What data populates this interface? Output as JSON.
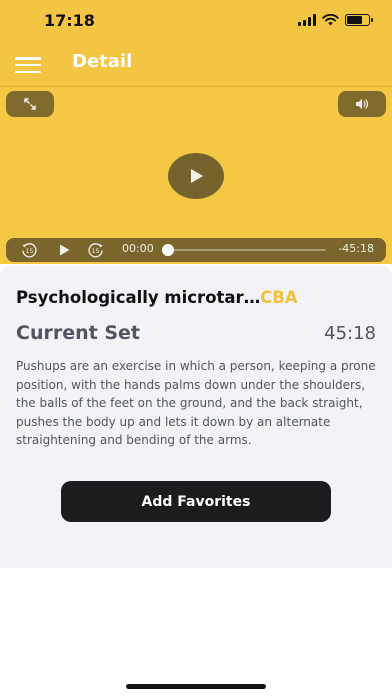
{
  "status_bar": {
    "time": "17:18",
    "icons": [
      "signal-icon",
      "wifi-icon",
      "battery-icon"
    ]
  },
  "app_bar": {
    "title": "Detail",
    "menu_icon": "hamburger-menu-icon"
  },
  "player": {
    "current_time": "00:00",
    "remaining_time": "-45:18",
    "progress": 0.0,
    "icons": [
      "expand-icon",
      "volume-icon",
      "play-icon",
      "rewind-15-icon",
      "forward-15-icon"
    ],
    "rewind_label": "15",
    "forward_label": "15"
  },
  "detail": {
    "title": "Psychologically microtar…",
    "title_tag": "CBA",
    "set_label": "Current Set",
    "set_time": "45:18",
    "description": "Pushups are an exercise in which a person, keeping a prone position, with the hands palms down under the shoulders, the balls of the feet on the ground, and the back straight, pushes the body up and lets it down by an alternate straightening and bending of the arms.",
    "favorite_button": "Add Favorites"
  },
  "colors": {
    "accent": "#f4c542",
    "tag": "#f0c23e",
    "button": "#1c1c1e",
    "card_bg": "#f2f2f7",
    "text_muted": "#505661"
  }
}
